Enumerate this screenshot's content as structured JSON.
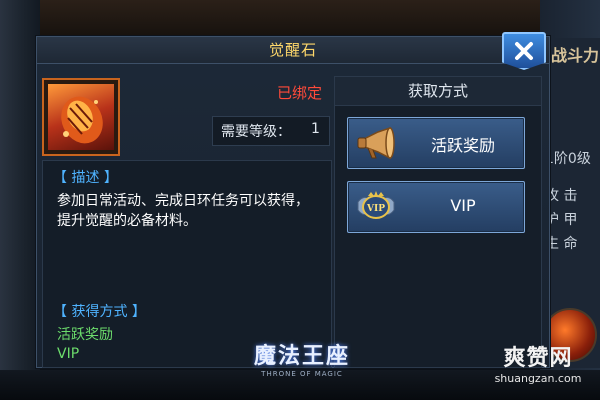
{
  "dialog": {
    "title": "觉醒石",
    "close_label": "X"
  },
  "item": {
    "icon": "awakening-stone-icon",
    "bound_status": "已绑定",
    "level_label": "需要等级：",
    "level_value": "1"
  },
  "description": {
    "heading": "【 描述 】",
    "text": "参加日常活动、完成日环任务可以获得，提升觉醒的必备材料。",
    "obtain_heading": "【 获得方式 】",
    "obtain_methods": [
      "活跃奖励",
      "VIP"
    ]
  },
  "acquire_panel": {
    "title": "获取方式",
    "buttons": [
      {
        "label": "活跃奖励",
        "icon": "horn-icon"
      },
      {
        "label": "VIP",
        "icon": "vip-badge-icon"
      }
    ]
  },
  "background_panel": {
    "title_fragment": "战斗力",
    "line": "1阶0级",
    "stats": [
      "攻 击",
      "护 甲",
      "生 命"
    ]
  },
  "branding": {
    "logo_text": "魔法王座",
    "logo_subtext": "THRONE OF MAGIC",
    "watermark_cn": "爽赞网",
    "watermark_en": "shuangzan.com"
  },
  "colors": {
    "title": "#ffd86a",
    "bound": "#ff4a3a",
    "heading": "#4fb3ff",
    "obtain": "#6cdc6c"
  }
}
